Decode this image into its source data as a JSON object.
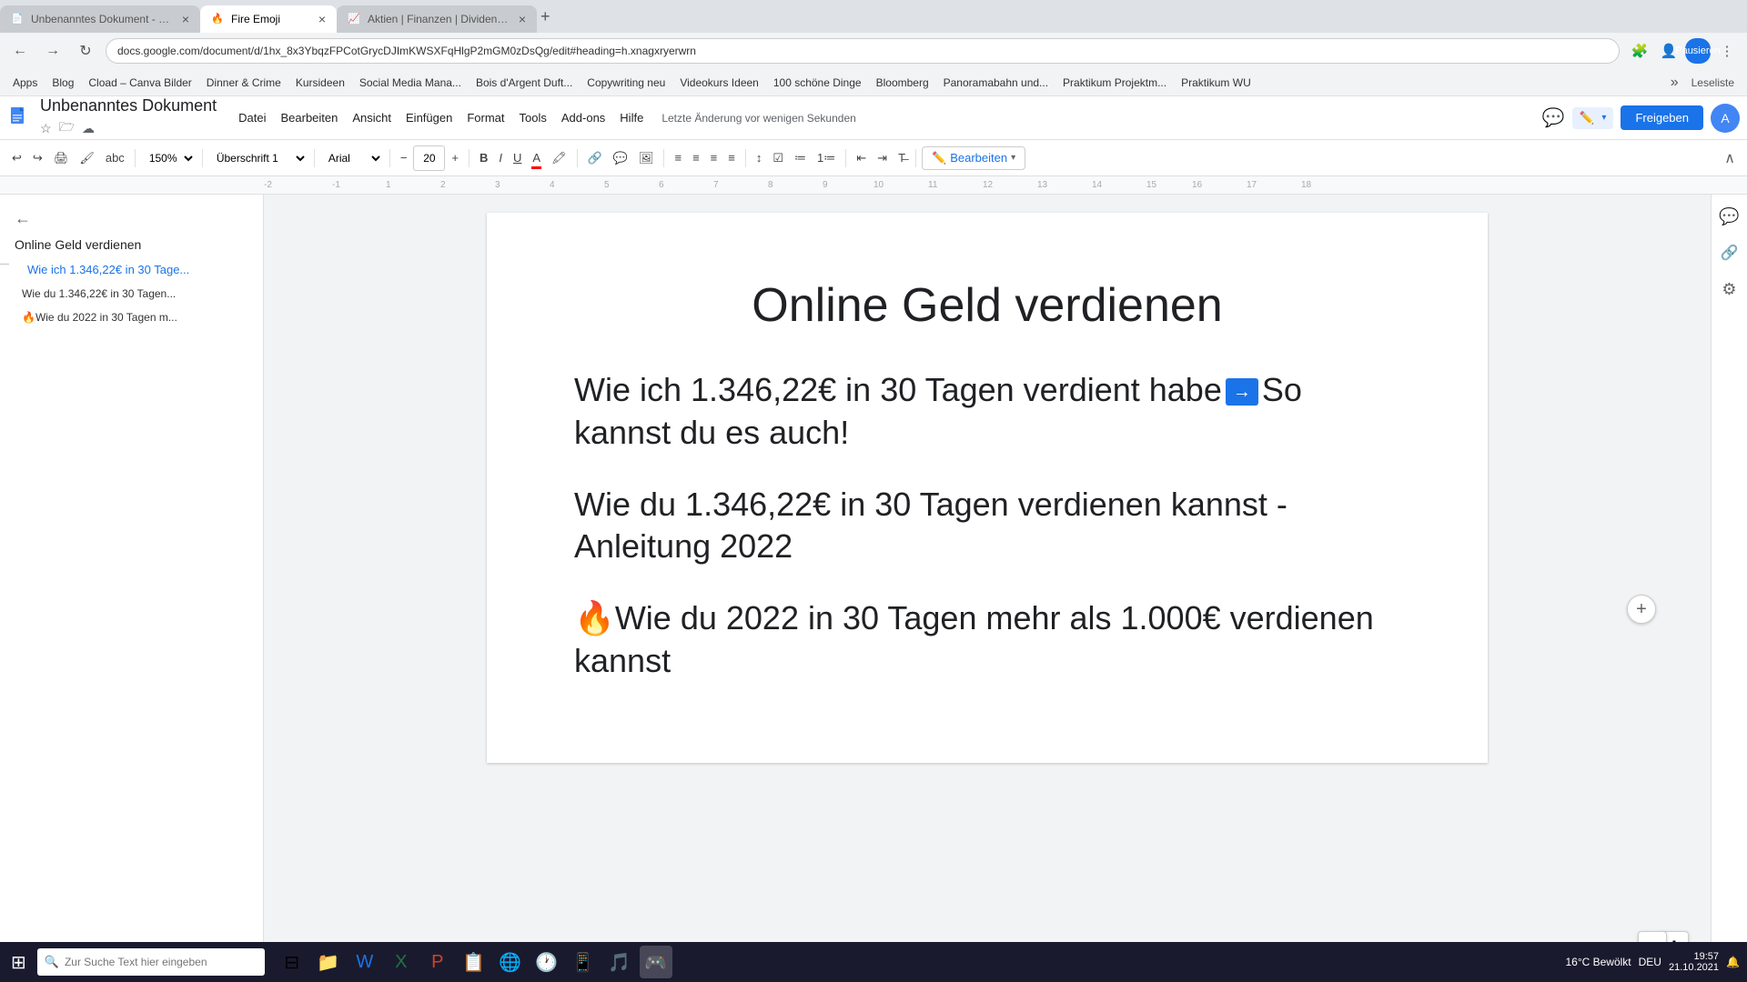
{
  "browser": {
    "tabs": [
      {
        "id": "tab1",
        "title": "Unbenanntes Dokument - Goo...",
        "favicon": "📄",
        "active": false
      },
      {
        "id": "tab2",
        "title": "Fire Emoji",
        "favicon": "🔥",
        "active": true
      },
      {
        "id": "tab3",
        "title": "Aktien | Finanzen | Dividende (..)",
        "favicon": "📈",
        "active": false
      }
    ],
    "address": "docs.google.com/document/d/1hx_8x3YbqzFPCotGrycDJImKWSXFqHlgP2mGM0zDsQg/edit#heading=h.xnagxryerwrn",
    "bookmarks": [
      "Apps",
      "Blog",
      "Cload – Canva Bilder",
      "Dinner & Crime",
      "Kursideen",
      "Social Media Mana...",
      "Bois d'Argent Duft...",
      "Copywriting neu",
      "Videokurs Ideen",
      "100 schöne Dinge",
      "Bloomberg",
      "Panoramabahn und...",
      "Praktikum Projektm...",
      "Praktikum WU"
    ],
    "reading_mode": "Leselistе"
  },
  "docs": {
    "title": "Unbenanntes Dokument",
    "menu": {
      "items": [
        "Datei",
        "Bearbeiten",
        "Ansicht",
        "Einfügen",
        "Format",
        "Tools",
        "Add-ons",
        "Hilfe"
      ]
    },
    "save_status": "Letzte Änderung vor wenigen Sekunden",
    "zoom": "150%",
    "heading_style": "Überschrift 1",
    "font": "Arial",
    "font_size": "20",
    "toolbar": {
      "bearbeiten_label": "Bearbeiten"
    }
  },
  "sidebar": {
    "items": [
      {
        "label": "Online Geld verdienen",
        "level": 1
      },
      {
        "label": "Wie ich 1.346,22€ in 30 Tage...",
        "level": 2
      },
      {
        "label": "Wie du 1.346,22€ in 30 Tagen...",
        "level": 3
      },
      {
        "label": "🔥Wie du 2022 in 30 Tagen m...",
        "level": 3
      }
    ]
  },
  "document": {
    "title": "Online Geld verdienen",
    "section1": {
      "text_before": "Wie ich 1.346,22€ in 30 Tagen verdient habe",
      "link_icon": "→",
      "text_after": "So kannst du es auch!"
    },
    "section2": {
      "text": "Wie du 1.346,22€ in 30 Tagen verdienen kannst - Anleitung 2022"
    },
    "section3": {
      "emoji": "🔥",
      "text": "Wie du 2022 in 30 Tagen mehr als 1.000€ verdienen kannst"
    }
  },
  "taskbar": {
    "search_placeholder": "Zur Suche Text hier eingeben",
    "weather": "16°C Bewölkt",
    "time": "19:57",
    "date": "21.10.2021",
    "keyboard_layout": "DEU"
  }
}
